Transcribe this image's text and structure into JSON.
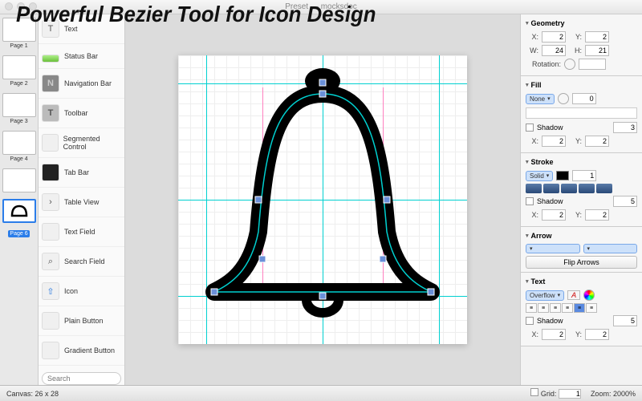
{
  "window": {
    "title": "Preset — mocksdoc"
  },
  "overlay": "Powerful Bezier Tool for Icon Design",
  "pages": [
    {
      "name": "Page 1"
    },
    {
      "name": "Page 2"
    },
    {
      "name": "Page 3"
    },
    {
      "name": "Page 4"
    },
    {
      "name": ""
    },
    {
      "name": "Page 6"
    }
  ],
  "selected_page": 5,
  "components": {
    "items": [
      "Text",
      "Status Bar",
      "Navigation Bar",
      "Toolbar",
      "Segmented Control",
      "Tab Bar",
      "Table View",
      "Text Field",
      "Search Field",
      "Icon",
      "Plain Button",
      "Gradient Button"
    ],
    "search_placeholder": "Search"
  },
  "inspector": {
    "geometry": {
      "title": "Geometry",
      "x": "2",
      "y": "2",
      "w": "24",
      "h": "21",
      "rotation_label": "Rotation:",
      "rotation": ""
    },
    "fill": {
      "title": "Fill",
      "mode": "None",
      "opacity": "0",
      "shadow_label": "Shadow",
      "shadow": "3",
      "sx": "2",
      "sy": "2"
    },
    "stroke": {
      "title": "Stroke",
      "mode": "Solid",
      "width": "1",
      "shadow_label": "Shadow",
      "shadow": "5",
      "sx": "2",
      "sy": "2"
    },
    "arrow": {
      "title": "Arrow",
      "flip": "Flip Arrows"
    },
    "text": {
      "title": "Text",
      "mode": "Overflow",
      "font_btn": "A",
      "shadow_label": "Shadow",
      "shadow": "5",
      "sx": "2",
      "sy": "2"
    }
  },
  "status": {
    "canvas": "Canvas: 26 x 28",
    "grid_label": "Grid:",
    "grid": "1",
    "zoom_label": "Zoom:",
    "zoom": "2000%"
  }
}
